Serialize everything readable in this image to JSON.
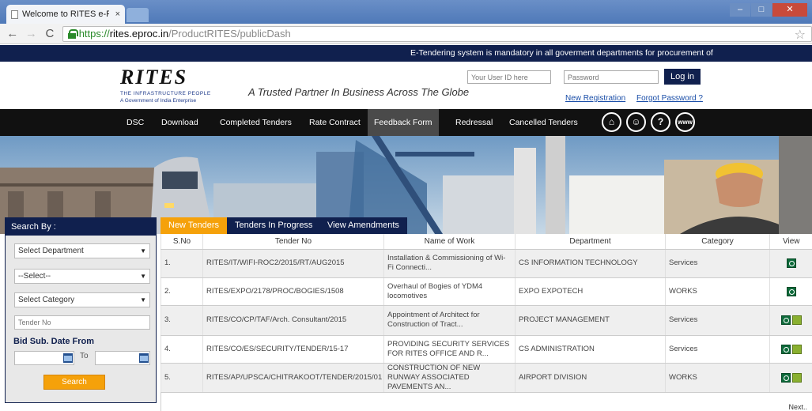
{
  "browser": {
    "tab_title": "Welcome to RITES e-Proc",
    "tab_close": "×",
    "url_scheme": "https://",
    "url_host": "rites.eproc.in",
    "url_path": "/ProductRITES/publicDash"
  },
  "notice": {
    "text": "E-Tendering system is mandatory in all goverment departments for procurement of"
  },
  "header": {
    "logo_text": "RITES",
    "logo_sub1": "THE INFRASTRUCTURE PEOPLE",
    "logo_sub2": "A Government of India Enterprise",
    "tagline": "A Trusted Partner In Business Across The Globe",
    "login": {
      "user_placeholder": "Your User ID here",
      "password_placeholder": "Password",
      "login_label": "Log in",
      "new_registration": "New Registration",
      "forgot_password": "Forgot Password ?"
    }
  },
  "nav": {
    "items": [
      "DSC",
      "Download",
      "Completed Tenders",
      "Rate Contract",
      "Feedback Form",
      "Redressal",
      "Cancelled Tenders"
    ],
    "icons": [
      {
        "name": "home-icon",
        "glyph": "⌂"
      },
      {
        "name": "support-icon",
        "glyph": "☺"
      },
      {
        "name": "help-icon",
        "glyph": "?"
      },
      {
        "name": "www-icon",
        "glyph": "www"
      }
    ]
  },
  "sidebar": {
    "title": "Search By :",
    "department": "Select Department",
    "select": "--Select--",
    "category": "Select Category",
    "tender_placeholder": "Tender No",
    "date_label": "Bid Sub. Date From",
    "to_label": "To",
    "search_label": "Search"
  },
  "tabs": [
    "New Tenders",
    "Tenders In Progress",
    "View Amendments"
  ],
  "table": {
    "headers": [
      "S.No",
      "Tender No",
      "Name of Work",
      "Department",
      "Category",
      "View"
    ],
    "rows": [
      {
        "sno": "1.",
        "tender": "RITES/IT/WIFI-ROC2/2015/RT/AUG2015",
        "work": "Installation & Commissioning of Wi-Fi Connecti...",
        "dept": "CS INFORMATION TECHNOLOGY",
        "cat": "Services",
        "icons": 1
      },
      {
        "sno": "2.",
        "tender": "RITES/EXPO/2178/PROC/BOGIES/1508",
        "work": "Overhaul of Bogies of YDM4 locomotives",
        "dept": "EXPO EXPOTECH",
        "cat": "WORKS",
        "icons": 1
      },
      {
        "sno": "3.",
        "tender": "RITES/CO/CP/TAF/Arch. Consultant/2015",
        "work": "Appointment of Architect for Construction of Tract...",
        "dept": "PROJECT MANAGEMENT",
        "cat": "Services",
        "icons": 2
      },
      {
        "sno": "4.",
        "tender": "RITES/CO/ES/SECURITY/TENDER/15-17",
        "work": "PROVIDING SECURITY SERVICES FOR RITES OFFICE AND R...",
        "dept": "CS ADMINISTRATION",
        "cat": "Services",
        "icons": 2
      },
      {
        "sno": "5.",
        "tender": "RITES/AP/UPSCA/CHITRAKOOT/TENDER/2015/01",
        "work": "CONSTRUCTION OF NEW RUNWAY ASSOCIATED PAVEMENTS AN...",
        "dept": "AIRPORT DIVISION",
        "cat": "WORKS",
        "icons": 2
      }
    ],
    "next_label": "Next.."
  },
  "colors": {
    "navy": "#10204e",
    "orange": "#f5a10a",
    "nav_black": "#111111",
    "link": "#1a4ea8"
  }
}
